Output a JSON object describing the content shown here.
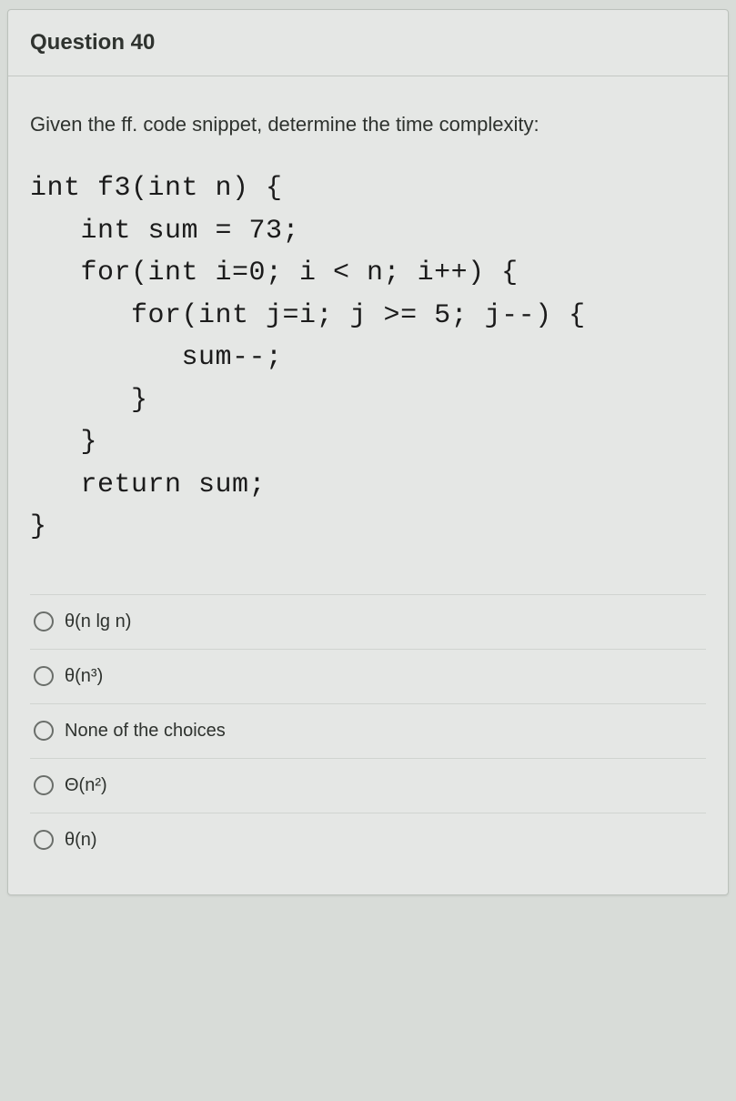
{
  "question": {
    "title": "Question 40",
    "prompt": "Given the ff. code snippet, determine the time complexity:",
    "code": "int f3(int n) {\n   int sum = 73;\n   for(int i=0; i < n; i++) {\n      for(int j=i; j >= 5; j--) {\n         sum--;\n      }\n   }\n   return sum;\n}",
    "options": [
      {
        "label": "θ(n lg n)"
      },
      {
        "label": "θ(n³)"
      },
      {
        "label": "None of the choices"
      },
      {
        "label": "Θ(n²)"
      },
      {
        "label": "θ(n)"
      }
    ]
  }
}
